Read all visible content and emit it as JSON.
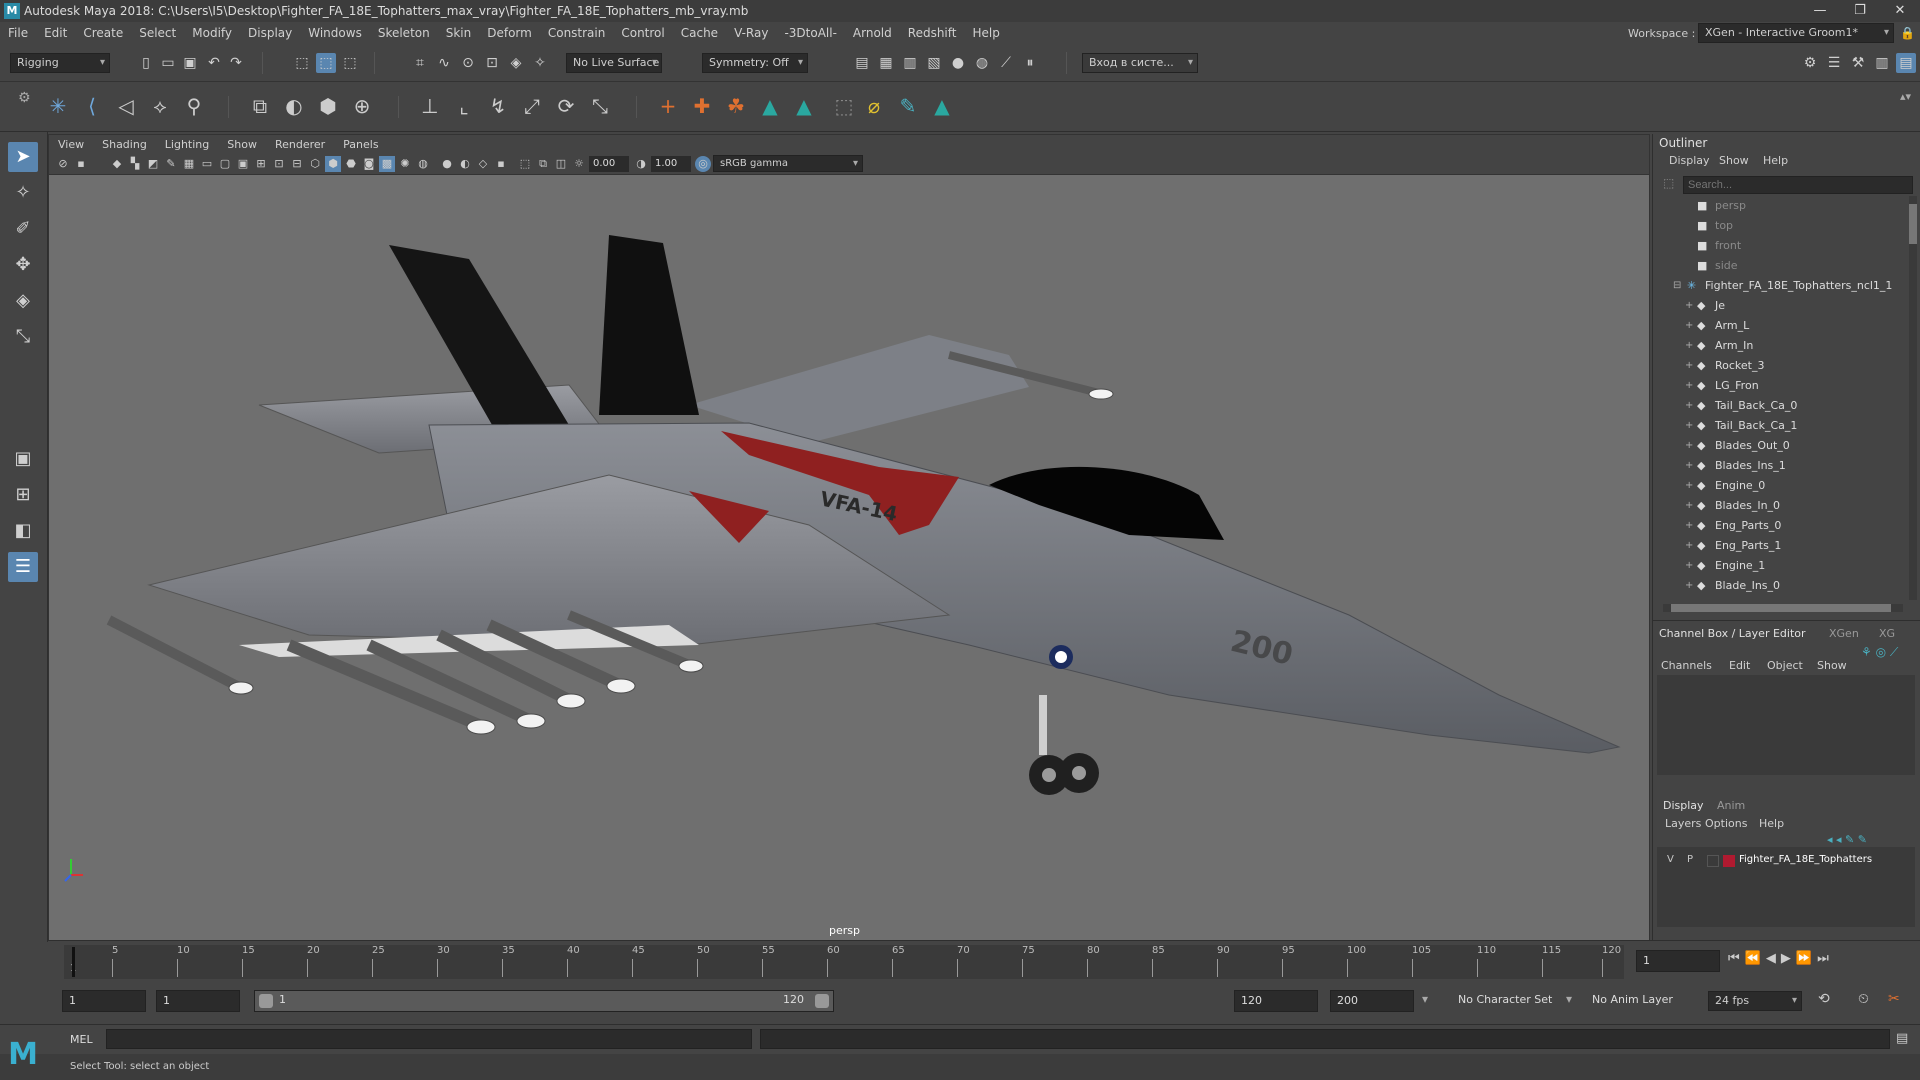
{
  "app": {
    "title": "Autodesk Maya 2018: C:\\Users\\I5\\Desktop\\Fighter_FA_18E_Tophatters_max_vray\\Fighter_FA_18E_Tophatters_mb_vray.mb",
    "logo": "M"
  },
  "menus": [
    "File",
    "Edit",
    "Create",
    "Select",
    "Modify",
    "Display",
    "Windows",
    "Skeleton",
    "Skin",
    "Deform",
    "Constrain",
    "Control",
    "Cache",
    "V-Ray",
    "-3DtoAll-",
    "Arnold",
    "Redshift",
    "Help"
  ],
  "workspace": {
    "label": "Workspace :",
    "value": "XGen - Interactive Groom1*"
  },
  "shelf": {
    "mode": "Rigging",
    "live_surface": "No Live Surface",
    "symmetry": "Symmetry: Off",
    "signin": "Вход в систе..."
  },
  "viewport": {
    "menus": [
      "View",
      "Shading",
      "Lighting",
      "Show",
      "Renderer",
      "Panels"
    ],
    "exposure": "0.00",
    "gamma": "1.00",
    "colorspace": "sRGB gamma",
    "camera": "persp"
  },
  "outliner": {
    "title": "Outliner",
    "menus": [
      "Display",
      "Show",
      "Help"
    ],
    "search_placeholder": "Search...",
    "cameras": [
      "persp",
      "top",
      "front",
      "side"
    ],
    "root": "Fighter_FA_18E_Tophatters_ncl1_1",
    "items": [
      "Je",
      "Arm_L",
      "Arm_In",
      "Rocket_3",
      "LG_Fron",
      "Tail_Back_Ca_0",
      "Tail_Back_Ca_1",
      "Blades_Out_0",
      "Blades_Ins_1",
      "Engine_0",
      "Blades_In_0",
      "Eng_Parts_0",
      "Eng_Parts_1",
      "Engine_1",
      "Blade_Ins_0"
    ]
  },
  "channelbox": {
    "title": "Channel Box / Layer Editor",
    "tabs": [
      "XGen",
      "XG"
    ],
    "menus": [
      "Channels",
      "Edit",
      "Object",
      "Show"
    ],
    "layer_tabs": [
      "Display",
      "Anim"
    ],
    "layer_menus": [
      "Layers",
      "Options",
      "Help"
    ],
    "layer": {
      "v": "V",
      "p": "P",
      "name": "Fighter_FA_18E_Tophatters",
      "color": "#b01a30"
    }
  },
  "timeline": {
    "ticks": [
      "1",
      "5",
      "10",
      "15",
      "20",
      "25",
      "30",
      "35",
      "40",
      "45",
      "50",
      "55",
      "60",
      "65",
      "70",
      "75",
      "80",
      "85",
      "90",
      "95",
      "100",
      "105",
      "110",
      "115",
      "120"
    ],
    "current_frame": "1"
  },
  "range": {
    "start": "1",
    "anim_start": "1",
    "slider_start": "1",
    "slider_end": "120",
    "end": "120",
    "anim_end": "200",
    "character_set": "No Character Set",
    "anim_layer": "No Anim Layer",
    "fps": "24 fps"
  },
  "mel": {
    "label": "MEL"
  },
  "status": {
    "text": "Select Tool: select an object"
  },
  "aircraft": {
    "squadron": "VFA-14",
    "number": "200"
  }
}
